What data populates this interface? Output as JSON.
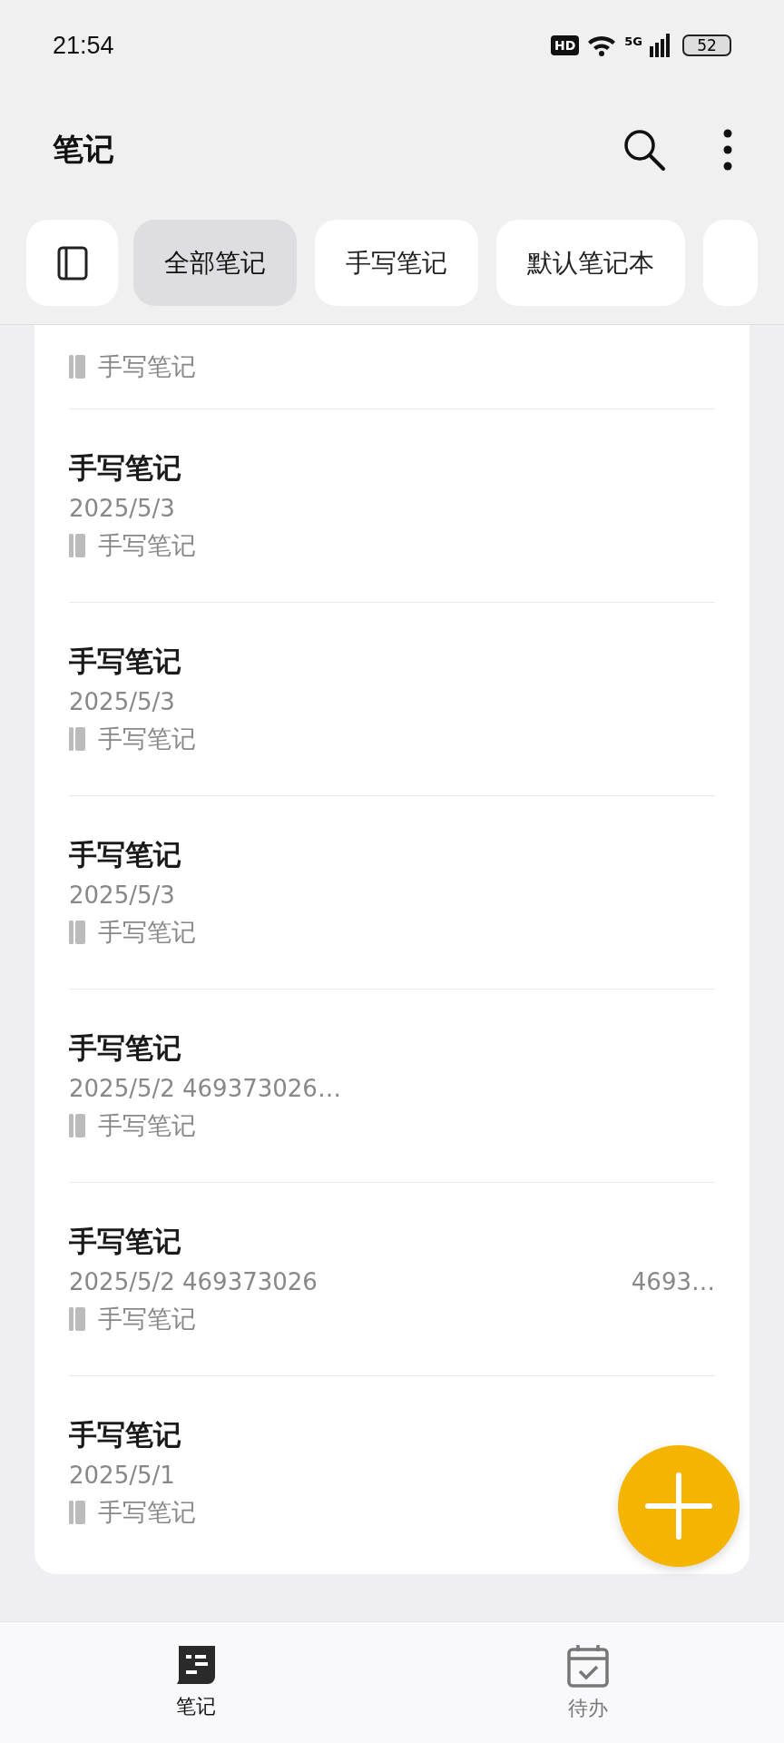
{
  "status_bar": {
    "time": "21:54",
    "hd_badge": "HD",
    "network": "5G",
    "battery": "52"
  },
  "header": {
    "title": "笔记"
  },
  "filters": [
    {
      "label": "全部笔记",
      "selected": true
    },
    {
      "label": "手写笔记",
      "selected": false
    },
    {
      "label": "默认笔记本",
      "selected": false
    }
  ],
  "notes": [
    {
      "notebook": "手写笔记"
    },
    {
      "title": "手写笔记",
      "date": "2025/5/3",
      "notebook": "手写笔记"
    },
    {
      "title": "手写笔记",
      "date": "2025/5/3",
      "notebook": "手写笔记"
    },
    {
      "title": "手写笔记",
      "date": "2025/5/3",
      "notebook": "手写笔记"
    },
    {
      "title": "手写笔记",
      "date": "2025/5/2 469373026…",
      "notebook": "手写笔记"
    },
    {
      "title": "手写笔记",
      "date": "2025/5/2 469373026",
      "extra": "4693…",
      "notebook": "手写笔记"
    },
    {
      "title": "手写笔记",
      "date": "2025/5/1",
      "notebook": "手写笔记"
    }
  ],
  "bottom_nav": [
    {
      "label": "笔记",
      "kind": "notes",
      "selected": true
    },
    {
      "label": "待办",
      "kind": "todo",
      "selected": false
    }
  ]
}
